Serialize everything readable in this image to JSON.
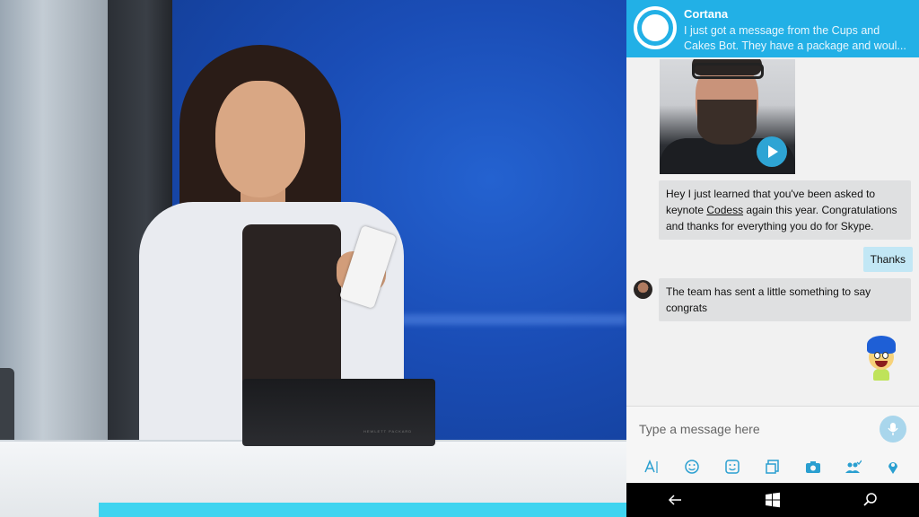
{
  "notification": {
    "app_name": "Cortana",
    "message": "I just got a message from the Cups and Cakes Bot. They have a package and woul..."
  },
  "chat": {
    "video_message": {
      "icon": "play-icon"
    },
    "messages": [
      {
        "sender": "other",
        "text_before": "Hey I just learned that you've been asked to keynote ",
        "link": "Codess",
        "text_after": " again this year. Congratulations and thanks for everything you do for Skype."
      },
      {
        "sender": "self",
        "text": "Thanks"
      },
      {
        "sender": "other",
        "text": "The team has sent a little something to say congrats"
      }
    ],
    "sticker": "joy-emoticon"
  },
  "composer": {
    "placeholder": "Type a message here",
    "mic_icon": "microphone-icon",
    "tools": [
      "text-format-icon",
      "emoji-icon",
      "sticker-icon",
      "file-icon",
      "camera-icon",
      "contacts-icon",
      "location-icon"
    ]
  },
  "navbar": {
    "items": [
      "back-icon",
      "windows-icon",
      "search-icon"
    ]
  },
  "stage": {
    "laptop_brand": "HEWLETT PACKARD"
  },
  "colors": {
    "accent": "#22b0e6",
    "self_bubble": "#c2e7f5",
    "other_bubble": "#dfe0e1",
    "panel_bg": "#f1f1f1"
  }
}
